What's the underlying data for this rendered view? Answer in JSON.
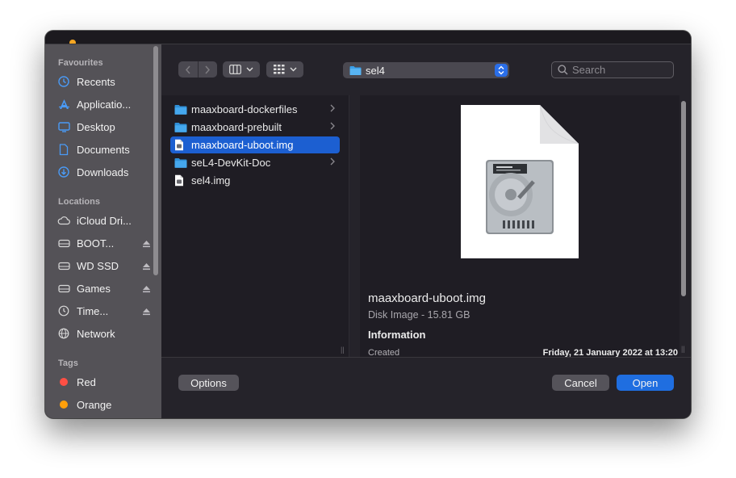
{
  "toolbar": {
    "path_label": "sel4",
    "search_placeholder": "Search"
  },
  "sidebar": {
    "favourites_header": "Favourites",
    "favourites": [
      {
        "label": "Recents",
        "icon": "clock-icon"
      },
      {
        "label": "Applicatio...",
        "icon": "applications-icon"
      },
      {
        "label": "Desktop",
        "icon": "desktop-icon"
      },
      {
        "label": "Documents",
        "icon": "document-icon"
      },
      {
        "label": "Downloads",
        "icon": "download-icon"
      }
    ],
    "locations_header": "Locations",
    "locations": [
      {
        "label": "iCloud Dri...",
        "icon": "cloud-icon"
      },
      {
        "label": "BOOT...",
        "icon": "drive-icon",
        "eject": true
      },
      {
        "label": "WD SSD",
        "icon": "drive-icon",
        "eject": true
      },
      {
        "label": "Games",
        "icon": "drive-icon",
        "eject": true
      },
      {
        "label": "Time...",
        "icon": "time-machine-icon",
        "eject": true
      },
      {
        "label": "Network",
        "icon": "network-icon"
      }
    ],
    "tags_header": "Tags",
    "tags": [
      {
        "label": "Red",
        "color": "#ff4f44"
      },
      {
        "label": "Orange",
        "color": "#ff9f0a"
      }
    ]
  },
  "files": [
    {
      "name": "maaxboard-dockerfiles",
      "kind": "folder",
      "selected": false
    },
    {
      "name": "maaxboard-prebuilt",
      "kind": "folder",
      "selected": false
    },
    {
      "name": "maaxboard-uboot.img",
      "kind": "file",
      "selected": true
    },
    {
      "name": "seL4-DevKit-Doc",
      "kind": "folder",
      "selected": false
    },
    {
      "name": "sel4.img",
      "kind": "file",
      "selected": false
    }
  ],
  "preview": {
    "name": "maaxboard-uboot.img",
    "kind": "Disk Image - 15.81 GB",
    "info_header": "Information",
    "created_label": "Created",
    "created_value": "Friday, 21 January 2022 at 13:20"
  },
  "buttons": {
    "options": "Options",
    "cancel": "Cancel",
    "open": "Open"
  },
  "colors": {
    "accent": "#1c5fd1",
    "folder": "#3aa0ea",
    "sidebar_icon": "#4a9af5"
  }
}
